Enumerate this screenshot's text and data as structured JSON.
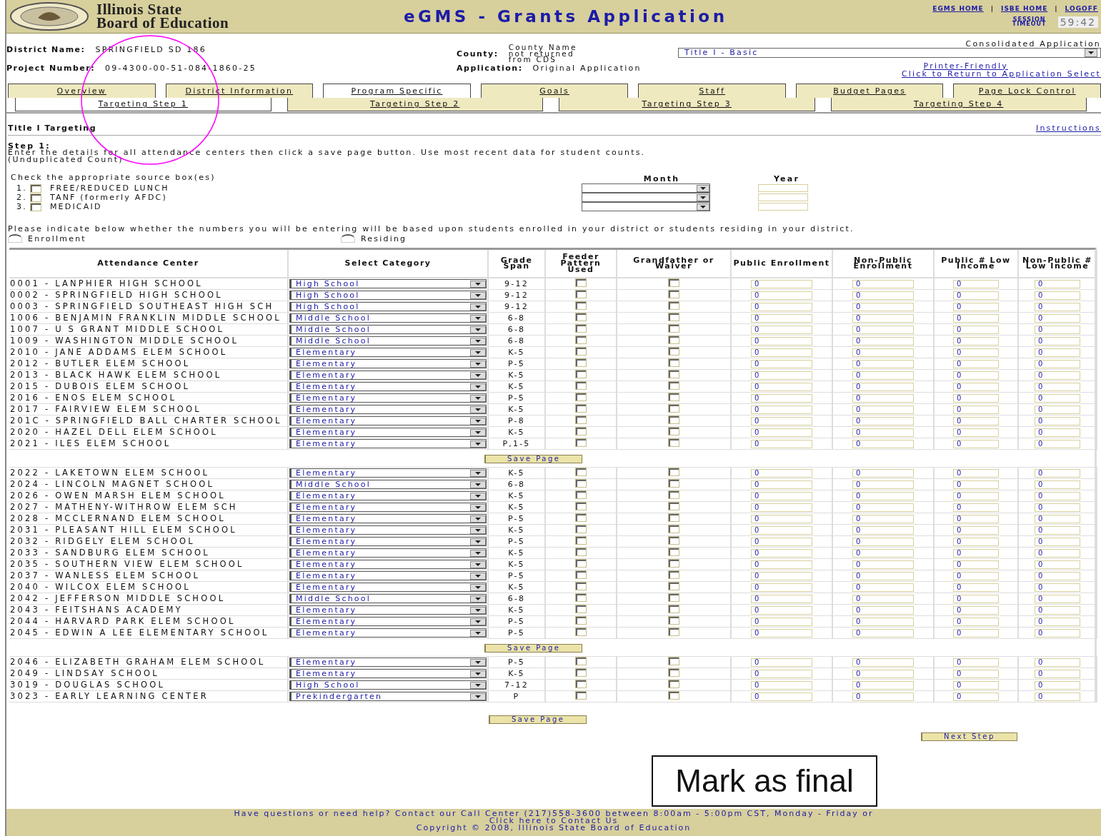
{
  "header": {
    "org_line1": "Illinois State",
    "org_line2": "Board of Education",
    "app_title": "eGMS - Grants Application",
    "links": [
      "EGMS HOME",
      "ISBE HOME",
      "LOGOFF"
    ],
    "link_separator": "|",
    "session_label": "SESSION TIMEOUT",
    "session_time": "59:42"
  },
  "info": {
    "district_label": "District Name:",
    "district": "SPRINGFIELD SD 186",
    "project_label": "Project Number:",
    "project": "09-4300-00-51-084-1860-25",
    "county_label": "County:",
    "county": "County Name not returned from CDS",
    "application_label": "Application:",
    "application": "Original Application",
    "consolidated": "Consolidated Application",
    "program": "Title I - Basic",
    "printer_link": "Printer-Friendly",
    "return_link": "Click to Return to Application Select"
  },
  "tabs": [
    {
      "label": "Overview",
      "selected": false
    },
    {
      "label": "District Information",
      "selected": false
    },
    {
      "label": "Program Specific",
      "selected": true
    },
    {
      "label": "Goals",
      "selected": false
    },
    {
      "label": "Staff",
      "selected": false
    },
    {
      "label": "Budget Pages",
      "selected": false
    },
    {
      "label": "Page Lock Control",
      "selected": false
    }
  ],
  "subtabs": [
    {
      "label": "Targeting Step 1",
      "selected": true
    },
    {
      "label": "Targeting Step 2",
      "selected": false
    },
    {
      "label": "Targeting Step 3",
      "selected": false
    },
    {
      "label": "Targeting Step 4",
      "selected": false
    }
  ],
  "section": {
    "title": "Title I Targeting",
    "instructions_link": "Instructions",
    "step": "Step 1:",
    "text": "Enter the details for all attendance centers then click a save page button. Use most recent data for student counts.",
    "note": "(Unduplicated Count)"
  },
  "sources": {
    "prompt": "Check the appropriate source box(es)",
    "month_label": "Month",
    "year_label": "Year",
    "items": [
      {
        "number": "1.",
        "label": "FREE/REDUCED LUNCH",
        "checked": false
      },
      {
        "number": "2.",
        "label": "TANF (formerly AFDC)",
        "checked": false
      },
      {
        "number": "3.",
        "label": "MEDICAID",
        "checked": false
      }
    ]
  },
  "basis": {
    "prompt": "Please indicate below whether the numbers you will be entering will be based upon students enrolled in your district or students residing in your district.",
    "options": [
      {
        "label": "Enrollment",
        "selected": false
      },
      {
        "label": "Residing",
        "selected": false
      }
    ]
  },
  "table": {
    "columns": [
      "Attendance Center",
      "Select Category",
      "Grade Span",
      "Feeder Pattern Used",
      "Grandfather or Waiver",
      "Public Enrollment",
      "Non-Public Enrollment",
      "Public # Low Income",
      "Non-Public # Low Income"
    ],
    "groups": [
      {
        "save_button": "Save Page",
        "rows": [
          {
            "center": "0001 - LANPHIER HIGH SCHOOL",
            "category": "High School",
            "grade_span": "9-12",
            "feeder": false,
            "grandfather": false,
            "public_enrollment": "0",
            "nonpublic_enrollment": "0",
            "public_low_income": "0",
            "nonpublic_low_income": "0"
          },
          {
            "center": "0002 - SPRINGFIELD HIGH SCHOOL",
            "category": "High School",
            "grade_span": "9-12",
            "feeder": false,
            "grandfather": false,
            "public_enrollment": "0",
            "nonpublic_enrollment": "0",
            "public_low_income": "0",
            "nonpublic_low_income": "0"
          },
          {
            "center": "0003 - SPRINGFIELD SOUTHEAST HIGH SCH",
            "category": "High School",
            "grade_span": "9-12",
            "feeder": false,
            "grandfather": false,
            "public_enrollment": "0",
            "nonpublic_enrollment": "0",
            "public_low_income": "0",
            "nonpublic_low_income": "0"
          },
          {
            "center": "1006 - BENJAMIN FRANKLIN MIDDLE SCHOOL",
            "category": "Middle School",
            "grade_span": "6-8",
            "feeder": false,
            "grandfather": false,
            "public_enrollment": "0",
            "nonpublic_enrollment": "0",
            "public_low_income": "0",
            "nonpublic_low_income": "0"
          },
          {
            "center": "1007 - U S GRANT MIDDLE SCHOOL",
            "category": "Middle School",
            "grade_span": "6-8",
            "feeder": false,
            "grandfather": false,
            "public_enrollment": "0",
            "nonpublic_enrollment": "0",
            "public_low_income": "0",
            "nonpublic_low_income": "0"
          },
          {
            "center": "1009 - WASHINGTON MIDDLE SCHOOL",
            "category": "Middle School",
            "grade_span": "6-8",
            "feeder": false,
            "grandfather": false,
            "public_enrollment": "0",
            "nonpublic_enrollment": "0",
            "public_low_income": "0",
            "nonpublic_low_income": "0"
          },
          {
            "center": "2010 - JANE ADDAMS ELEM SCHOOL",
            "category": "Elementary",
            "grade_span": "K-5",
            "feeder": false,
            "grandfather": false,
            "public_enrollment": "0",
            "nonpublic_enrollment": "0",
            "public_low_income": "0",
            "nonpublic_low_income": "0"
          },
          {
            "center": "2012 - BUTLER ELEM SCHOOL",
            "category": "Elementary",
            "grade_span": "P-5",
            "feeder": false,
            "grandfather": false,
            "public_enrollment": "0",
            "nonpublic_enrollment": "0",
            "public_low_income": "0",
            "nonpublic_low_income": "0"
          },
          {
            "center": "2013 - BLACK HAWK ELEM SCHOOL",
            "category": "Elementary",
            "grade_span": "K-5",
            "feeder": false,
            "grandfather": false,
            "public_enrollment": "0",
            "nonpublic_enrollment": "0",
            "public_low_income": "0",
            "nonpublic_low_income": "0"
          },
          {
            "center": "2015 - DUBOIS ELEM SCHOOL",
            "category": "Elementary",
            "grade_span": "K-5",
            "feeder": false,
            "grandfather": false,
            "public_enrollment": "0",
            "nonpublic_enrollment": "0",
            "public_low_income": "0",
            "nonpublic_low_income": "0"
          },
          {
            "center": "2016 - ENOS ELEM SCHOOL",
            "category": "Elementary",
            "grade_span": "P-5",
            "feeder": false,
            "grandfather": false,
            "public_enrollment": "0",
            "nonpublic_enrollment": "0",
            "public_low_income": "0",
            "nonpublic_low_income": "0"
          },
          {
            "center": "2017 - FAIRVIEW ELEM SCHOOL",
            "category": "Elementary",
            "grade_span": "K-5",
            "feeder": false,
            "grandfather": false,
            "public_enrollment": "0",
            "nonpublic_enrollment": "0",
            "public_low_income": "0",
            "nonpublic_low_income": "0"
          },
          {
            "center": "201C - SPRINGFIELD BALL CHARTER SCHOOL",
            "category": "Elementary",
            "grade_span": "P-8",
            "feeder": false,
            "grandfather": false,
            "public_enrollment": "0",
            "nonpublic_enrollment": "0",
            "public_low_income": "0",
            "nonpublic_low_income": "0"
          },
          {
            "center": "2020 - HAZEL DELL ELEM SCHOOL",
            "category": "Elementary",
            "grade_span": "K-5",
            "feeder": false,
            "grandfather": false,
            "public_enrollment": "0",
            "nonpublic_enrollment": "0",
            "public_low_income": "0",
            "nonpublic_low_income": "0"
          },
          {
            "center": "2021 - ILES ELEM SCHOOL",
            "category": "Elementary",
            "grade_span": "P,1-5",
            "feeder": false,
            "grandfather": false,
            "public_enrollment": "0",
            "nonpublic_enrollment": "0",
            "public_low_income": "0",
            "nonpublic_low_income": "0"
          }
        ]
      },
      {
        "save_button": "Save Page",
        "rows": [
          {
            "center": "2022 - LAKETOWN ELEM SCHOOL",
            "category": "Elementary",
            "grade_span": "K-5",
            "feeder": false,
            "grandfather": false,
            "public_enrollment": "0",
            "nonpublic_enrollment": "0",
            "public_low_income": "0",
            "nonpublic_low_income": "0"
          },
          {
            "center": "2024 - LINCOLN MAGNET SCHOOL",
            "category": "Middle School",
            "grade_span": "6-8",
            "feeder": false,
            "grandfather": false,
            "public_enrollment": "0",
            "nonpublic_enrollment": "0",
            "public_low_income": "0",
            "nonpublic_low_income": "0"
          },
          {
            "center": "2026 - OWEN MARSH ELEM SCHOOL",
            "category": "Elementary",
            "grade_span": "K-5",
            "feeder": false,
            "grandfather": false,
            "public_enrollment": "0",
            "nonpublic_enrollment": "0",
            "public_low_income": "0",
            "nonpublic_low_income": "0"
          },
          {
            "center": "2027 - MATHENY-WITHROW ELEM SCH",
            "category": "Elementary",
            "grade_span": "K-5",
            "feeder": false,
            "grandfather": false,
            "public_enrollment": "0",
            "nonpublic_enrollment": "0",
            "public_low_income": "0",
            "nonpublic_low_income": "0"
          },
          {
            "center": "2028 - MCCLERNAND ELEM SCHOOL",
            "category": "Elementary",
            "grade_span": "P-5",
            "feeder": false,
            "grandfather": false,
            "public_enrollment": "0",
            "nonpublic_enrollment": "0",
            "public_low_income": "0",
            "nonpublic_low_income": "0"
          },
          {
            "center": "2031 - PLEASANT HILL ELEM SCHOOL",
            "category": "Elementary",
            "grade_span": "K-5",
            "feeder": false,
            "grandfather": false,
            "public_enrollment": "0",
            "nonpublic_enrollment": "0",
            "public_low_income": "0",
            "nonpublic_low_income": "0"
          },
          {
            "center": "2032 - RIDGELY ELEM SCHOOL",
            "category": "Elementary",
            "grade_span": "P-5",
            "feeder": false,
            "grandfather": false,
            "public_enrollment": "0",
            "nonpublic_enrollment": "0",
            "public_low_income": "0",
            "nonpublic_low_income": "0"
          },
          {
            "center": "2033 - SANDBURG ELEM SCHOOL",
            "category": "Elementary",
            "grade_span": "K-5",
            "feeder": false,
            "grandfather": false,
            "public_enrollment": "0",
            "nonpublic_enrollment": "0",
            "public_low_income": "0",
            "nonpublic_low_income": "0"
          },
          {
            "center": "2035 - SOUTHERN VIEW ELEM SCHOOL",
            "category": "Elementary",
            "grade_span": "K-5",
            "feeder": false,
            "grandfather": false,
            "public_enrollment": "0",
            "nonpublic_enrollment": "0",
            "public_low_income": "0",
            "nonpublic_low_income": "0"
          },
          {
            "center": "2037 - WANLESS ELEM SCHOOL",
            "category": "Elementary",
            "grade_span": "P-5",
            "feeder": false,
            "grandfather": false,
            "public_enrollment": "0",
            "nonpublic_enrollment": "0",
            "public_low_income": "0",
            "nonpublic_low_income": "0"
          },
          {
            "center": "2040 - WILCOX ELEM SCHOOL",
            "category": "Elementary",
            "grade_span": "K-5",
            "feeder": false,
            "grandfather": false,
            "public_enrollment": "0",
            "nonpublic_enrollment": "0",
            "public_low_income": "0",
            "nonpublic_low_income": "0"
          },
          {
            "center": "2042 - JEFFERSON MIDDLE SCHOOL",
            "category": "Middle School",
            "grade_span": "6-8",
            "feeder": false,
            "grandfather": false,
            "public_enrollment": "0",
            "nonpublic_enrollment": "0",
            "public_low_income": "0",
            "nonpublic_low_income": "0"
          },
          {
            "center": "2043 - FEITSHANS ACADEMY",
            "category": "Elementary",
            "grade_span": "K-5",
            "feeder": false,
            "grandfather": false,
            "public_enrollment": "0",
            "nonpublic_enrollment": "0",
            "public_low_income": "0",
            "nonpublic_low_income": "0"
          },
          {
            "center": "2044 - HARVARD PARK ELEM SCHOOL",
            "category": "Elementary",
            "grade_span": "P-5",
            "feeder": false,
            "grandfather": false,
            "public_enrollment": "0",
            "nonpublic_enrollment": "0",
            "public_low_income": "0",
            "nonpublic_low_income": "0"
          },
          {
            "center": "2045 - EDWIN A LEE ELEMENTARY SCHOOL",
            "category": "Elementary",
            "grade_span": "P-5",
            "feeder": false,
            "grandfather": false,
            "public_enrollment": "0",
            "nonpublic_enrollment": "0",
            "public_low_income": "0",
            "nonpublic_low_income": "0"
          }
        ]
      },
      {
        "rows": [
          {
            "center": "2046 - ELIZABETH GRAHAM ELEM SCHOOL",
            "category": "Elementary",
            "grade_span": "P-5",
            "feeder": false,
            "grandfather": false,
            "public_enrollment": "0",
            "nonpublic_enrollment": "0",
            "public_low_income": "0",
            "nonpublic_low_income": "0"
          },
          {
            "center": "2049 - LINDSAY SCHOOL",
            "category": "Elementary",
            "grade_span": "K-5",
            "feeder": false,
            "grandfather": false,
            "public_enrollment": "0",
            "nonpublic_enrollment": "0",
            "public_low_income": "0",
            "nonpublic_low_income": "0"
          },
          {
            "center": "3019 - DOUGLAS SCHOOL",
            "category": "High School",
            "grade_span": "7-12",
            "feeder": false,
            "grandfather": false,
            "public_enrollment": "0",
            "nonpublic_enrollment": "0",
            "public_low_income": "0",
            "nonpublic_low_income": "0"
          },
          {
            "center": "3023 - EARLY LEARNING CENTER",
            "category": "Prekindergarten",
            "grade_span": "P",
            "feeder": false,
            "grandfather": false,
            "public_enrollment": "0",
            "nonpublic_enrollment": "0",
            "public_low_income": "0",
            "nonpublic_low_income": "0"
          }
        ]
      }
    ]
  },
  "save_button": "Save Page",
  "next_button": "Next Step",
  "callout": "Mark as final",
  "footer": {
    "help": "Have questions or need help? Contact our Call Center (217)558-3600 between 8:00am - 5:00pm CST, Monday - Friday or",
    "contact_link": "Click here to Contact Us",
    "copyright": "Copyright © 2008, Illinois State Board of Education"
  }
}
